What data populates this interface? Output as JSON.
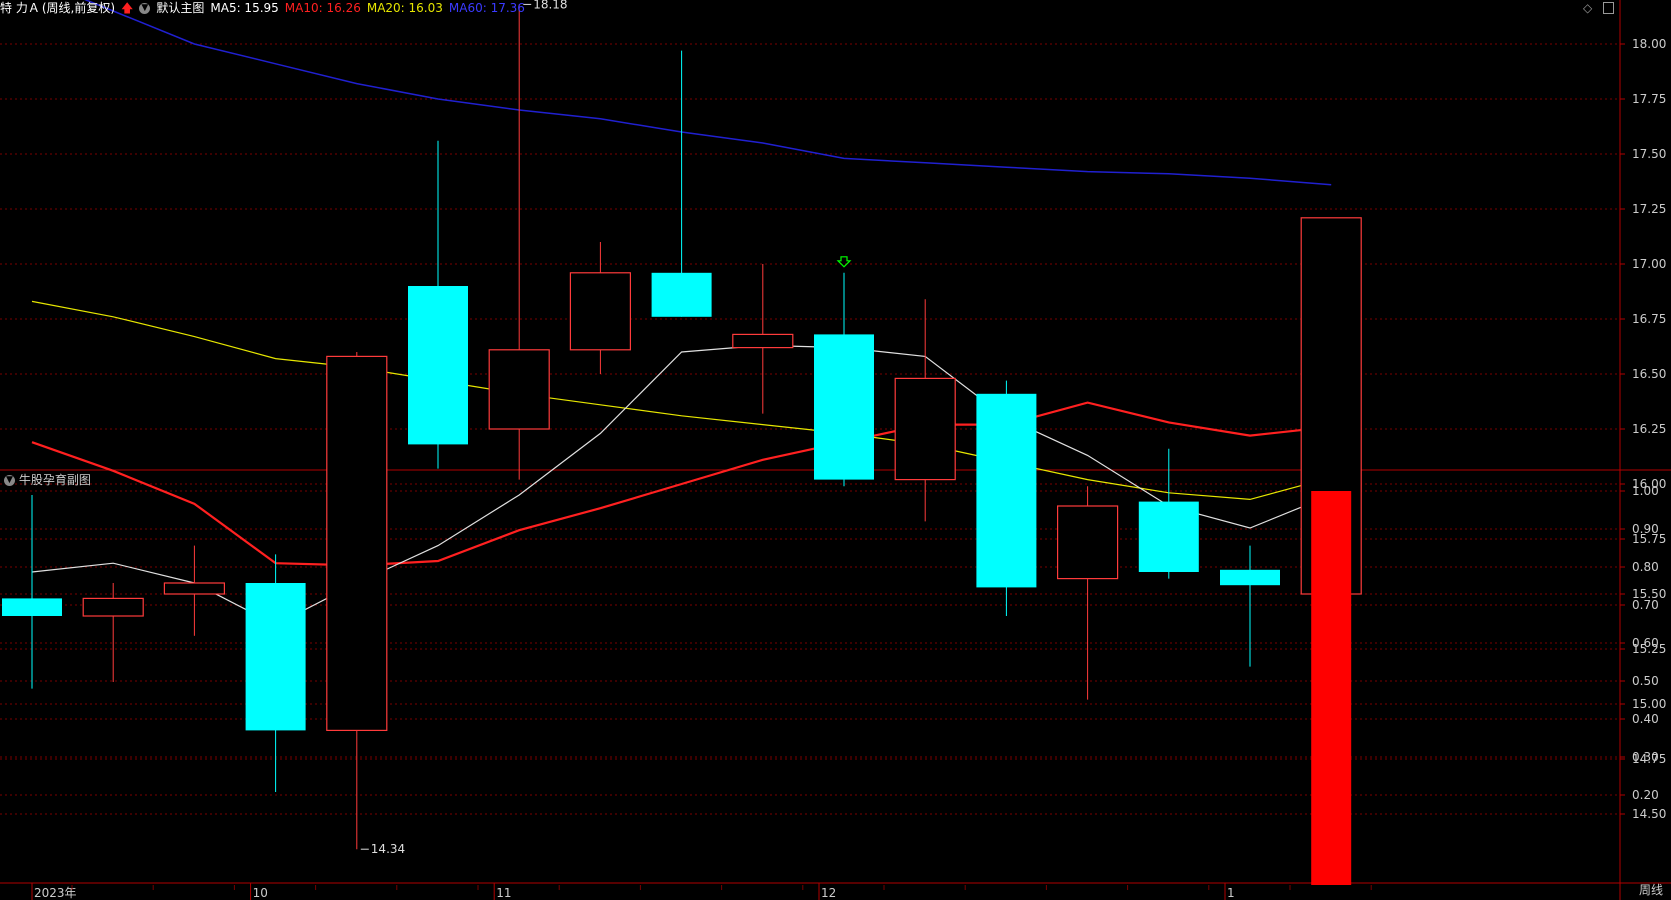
{
  "header": {
    "stock_name": "特 力Ａ",
    "mode": "(周线,前复权)",
    "main_label": "默认主图",
    "ma5_label": "MA5: 15.95",
    "ma10_label": "MA10: 16.26",
    "ma20_label": "MA20: 16.03",
    "ma60_label": "MA60: 17.36"
  },
  "sub_panel": {
    "title": "牛股孕育副图"
  },
  "period_label": "周线",
  "colors": {
    "up": "#ff3b3b",
    "down": "#00ffff",
    "ma5": "#e0e0e0",
    "ma10": "#ff2020",
    "ma20": "#e6e600",
    "ma60": "#2020d0",
    "grid": "#7a0000",
    "axis_text": "#cccccc",
    "signal_bar": "#ff0000"
  },
  "chart_data": [
    {
      "type": "candlestick",
      "y_ticks": [
        "18.00",
        "17.75",
        "17.50",
        "17.25",
        "17.00",
        "16.75",
        "16.50",
        "16.25",
        "16.00",
        "15.75",
        "15.50",
        "15.25",
        "15.00",
        "14.75",
        "14.50"
      ],
      "ylim": [
        14.3,
        18.4
      ],
      "x_labels": [
        {
          "index": 0,
          "label": "2023年"
        },
        {
          "index": 3,
          "label": "10"
        },
        {
          "index": 6,
          "label": "11"
        },
        {
          "index": 10,
          "label": "12"
        },
        {
          "index": 15,
          "label": "1"
        }
      ],
      "candles": [
        {
          "o": 15.48,
          "c": 15.4,
          "h": 15.95,
          "l": 15.07
        },
        {
          "o": 15.4,
          "c": 15.48,
          "h": 15.55,
          "l": 15.1
        },
        {
          "o": 15.5,
          "c": 15.55,
          "h": 15.72,
          "l": 15.31
        },
        {
          "o": 15.55,
          "c": 14.88,
          "h": 15.68,
          "l": 14.6
        },
        {
          "o": 14.88,
          "c": 16.58,
          "h": 16.6,
          "l": 14.34
        },
        {
          "o": 16.9,
          "c": 16.18,
          "h": 17.56,
          "l": 16.07
        },
        {
          "o": 16.25,
          "c": 16.61,
          "h": 18.18,
          "l": 16.02
        },
        {
          "o": 16.61,
          "c": 16.96,
          "h": 17.1,
          "l": 16.5
        },
        {
          "o": 16.96,
          "c": 16.76,
          "h": 17.97,
          "l": 16.76
        },
        {
          "o": 16.62,
          "c": 16.68,
          "h": 17.0,
          "l": 16.32
        },
        {
          "o": 16.68,
          "c": 16.02,
          "h": 16.96,
          "l": 15.99
        },
        {
          "o": 16.02,
          "c": 16.48,
          "h": 16.84,
          "l": 15.83
        },
        {
          "o": 16.41,
          "c": 15.53,
          "h": 16.47,
          "l": 15.4
        },
        {
          "o": 15.57,
          "c": 15.9,
          "h": 15.99,
          "l": 15.02
        },
        {
          "o": 15.92,
          "c": 15.6,
          "h": 16.16,
          "l": 15.57
        },
        {
          "o": 15.61,
          "c": 15.54,
          "h": 15.72,
          "l": 15.17
        },
        {
          "o": 15.5,
          "c": 17.21,
          "h": 17.21,
          "l": 14.9
        }
      ],
      "ma5": [
        15.6,
        15.64,
        15.55,
        15.36,
        15.55,
        15.72,
        15.95,
        16.23,
        16.6,
        16.63,
        16.62,
        16.58,
        16.3,
        16.13,
        15.9,
        15.8,
        15.95
      ],
      "ma10": [
        16.19,
        16.06,
        15.91,
        15.64,
        15.63,
        15.65,
        15.79,
        15.89,
        16.0,
        16.11,
        16.19,
        16.27,
        16.27,
        16.37,
        16.28,
        16.22,
        16.26
      ],
      "ma20": [
        16.83,
        16.76,
        16.67,
        16.57,
        16.53,
        16.47,
        16.41,
        16.36,
        16.31,
        16.27,
        16.23,
        16.18,
        16.1,
        16.02,
        15.96,
        15.93,
        16.03
      ],
      "ma60": [
        18.3,
        18.15,
        18.0,
        17.91,
        17.82,
        17.75,
        17.7,
        17.66,
        17.6,
        17.55,
        17.48,
        17.46,
        17.44,
        17.42,
        17.41,
        17.39,
        17.36
      ],
      "annotations": [
        {
          "label": "18.18",
          "index": 6,
          "value": 18.18
        },
        {
          "label": "14.34",
          "index": 4,
          "value": 14.34
        }
      ],
      "signals": [
        {
          "type": "down-arrow",
          "index": 10,
          "color": "#00ff00"
        },
        {
          "type": "up-arrow",
          "index": 16,
          "color": "#ff0000"
        }
      ]
    },
    {
      "type": "bar",
      "title": "牛股孕育副图",
      "y_ticks": [
        "1.00",
        "0.90",
        "0.80",
        "0.70",
        "0.60",
        "0.50",
        "0.40",
        "0.30",
        "0.20"
      ],
      "ylim": [
        0,
        1.05
      ],
      "values": [
        0,
        0,
        0,
        0,
        0,
        0,
        0,
        0,
        0,
        0,
        0,
        0,
        0,
        0,
        0,
        0,
        1.0
      ]
    }
  ]
}
